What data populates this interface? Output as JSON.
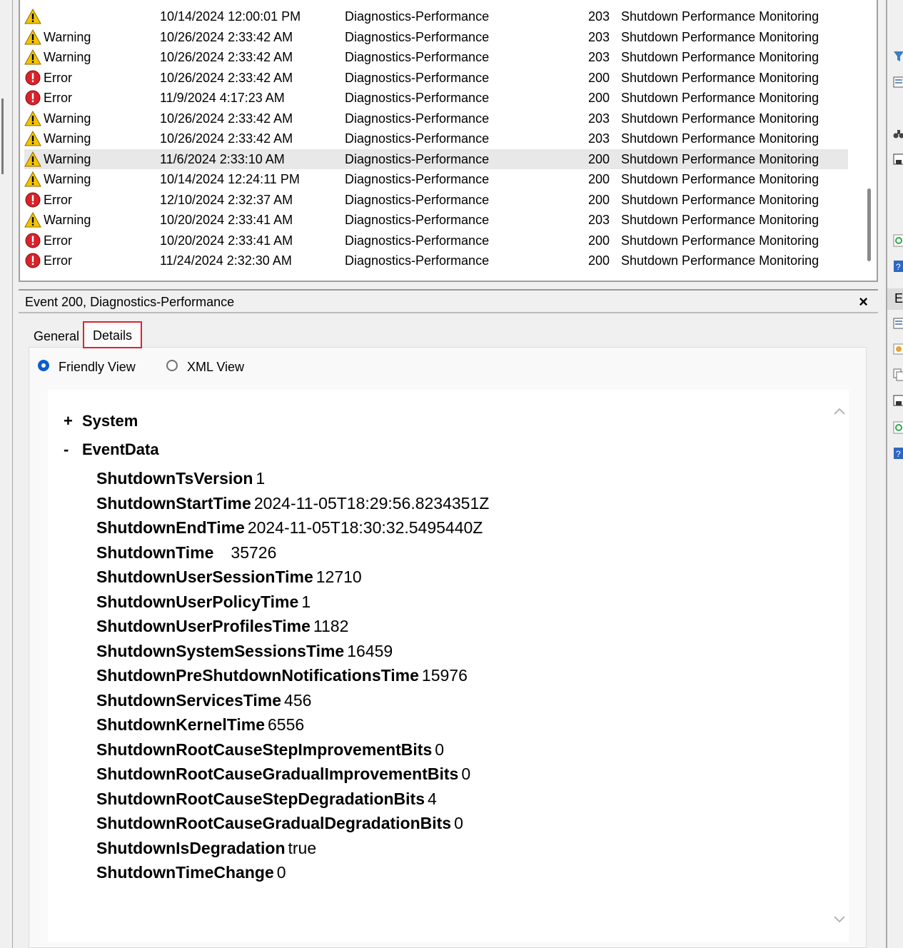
{
  "events": [
    {
      "level": "",
      "icon": "warning",
      "date": "10/14/2024 12:00:01 PM",
      "source": "Diagnostics-Performance",
      "id": "203",
      "task": "Shutdown Performance Monitoring"
    },
    {
      "level": "Warning",
      "icon": "warning",
      "date": "10/26/2024 2:33:42 AM",
      "source": "Diagnostics-Performance",
      "id": "203",
      "task": "Shutdown Performance Monitoring"
    },
    {
      "level": "Warning",
      "icon": "warning",
      "date": "10/26/2024 2:33:42 AM",
      "source": "Diagnostics-Performance",
      "id": "203",
      "task": "Shutdown Performance Monitoring"
    },
    {
      "level": "Error",
      "icon": "error",
      "date": "10/26/2024 2:33:42 AM",
      "source": "Diagnostics-Performance",
      "id": "200",
      "task": "Shutdown Performance Monitoring"
    },
    {
      "level": "Error",
      "icon": "error",
      "date": "11/9/2024 4:17:23 AM",
      "source": "Diagnostics-Performance",
      "id": "200",
      "task": "Shutdown Performance Monitoring"
    },
    {
      "level": "Warning",
      "icon": "warning",
      "date": "10/26/2024 2:33:42 AM",
      "source": "Diagnostics-Performance",
      "id": "203",
      "task": "Shutdown Performance Monitoring"
    },
    {
      "level": "Warning",
      "icon": "warning",
      "date": "10/26/2024 2:33:42 AM",
      "source": "Diagnostics-Performance",
      "id": "203",
      "task": "Shutdown Performance Monitoring"
    },
    {
      "level": "Warning",
      "icon": "warning",
      "date": "11/6/2024 2:33:10 AM",
      "source": "Diagnostics-Performance",
      "id": "200",
      "task": "Shutdown Performance Monitoring",
      "selected": true
    },
    {
      "level": "Warning",
      "icon": "warning",
      "date": "10/14/2024 12:24:11 PM",
      "source": "Diagnostics-Performance",
      "id": "200",
      "task": "Shutdown Performance Monitoring"
    },
    {
      "level": "Error",
      "icon": "error",
      "date": "12/10/2024 2:32:37 AM",
      "source": "Diagnostics-Performance",
      "id": "200",
      "task": "Shutdown Performance Monitoring"
    },
    {
      "level": "Warning",
      "icon": "warning",
      "date": "10/20/2024 2:33:41 AM",
      "source": "Diagnostics-Performance",
      "id": "203",
      "task": "Shutdown Performance Monitoring"
    },
    {
      "level": "Error",
      "icon": "error",
      "date": "10/20/2024 2:33:41 AM",
      "source": "Diagnostics-Performance",
      "id": "200",
      "task": "Shutdown Performance Monitoring"
    },
    {
      "level": "Error",
      "icon": "error",
      "date": "11/24/2024 2:32:30 AM",
      "source": "Diagnostics-Performance",
      "id": "200",
      "task": "Shutdown Performance Monitoring"
    }
  ],
  "detail": {
    "title": "Event 200, Diagnostics-Performance",
    "close": "×",
    "tabs": {
      "general": "General",
      "details": "Details"
    },
    "views": {
      "friendly": "Friendly View",
      "xml": "XML View"
    },
    "tree": {
      "system": "System",
      "system_sign": "+",
      "eventdata": "EventData",
      "eventdata_sign": "-"
    },
    "fields": [
      {
        "key": "ShutdownTsVersion",
        "value": "1"
      },
      {
        "key": "ShutdownStartTime",
        "value": "2024-11-05T18:29:56.8234351Z"
      },
      {
        "key": "ShutdownEndTime",
        "value": "2024-11-05T18:30:32.5495440Z"
      },
      {
        "key": "ShutdownTime",
        "value": "35726",
        "wide": true
      },
      {
        "key": "ShutdownUserSessionTime",
        "value": "12710"
      },
      {
        "key": "ShutdownUserPolicyTime",
        "value": "1"
      },
      {
        "key": "ShutdownUserProfilesTime",
        "value": "1182"
      },
      {
        "key": "ShutdownSystemSessionsTime",
        "value": "16459"
      },
      {
        "key": "ShutdownPreShutdownNotificationsTime",
        "value": "15976"
      },
      {
        "key": "ShutdownServicesTime",
        "value": "456"
      },
      {
        "key": "ShutdownKernelTime",
        "value": "6556"
      },
      {
        "key": "ShutdownRootCauseStepImprovementBits",
        "value": "0"
      },
      {
        "key": "ShutdownRootCauseGradualImprovementBits",
        "value": "0"
      },
      {
        "key": "ShutdownRootCauseStepDegradationBits",
        "value": "4"
      },
      {
        "key": "ShutdownRootCauseGradualDegradationBits",
        "value": "0"
      },
      {
        "key": "ShutdownIsDegradation",
        "value": "true"
      },
      {
        "key": "ShutdownTimeChange",
        "value": "0"
      }
    ]
  },
  "actions_panel": {
    "selected_label": "E"
  },
  "colors": {
    "warning": "#f5c400",
    "error": "#d9222a",
    "accent": "#0a5fc8",
    "highlight": "#d7262e"
  }
}
